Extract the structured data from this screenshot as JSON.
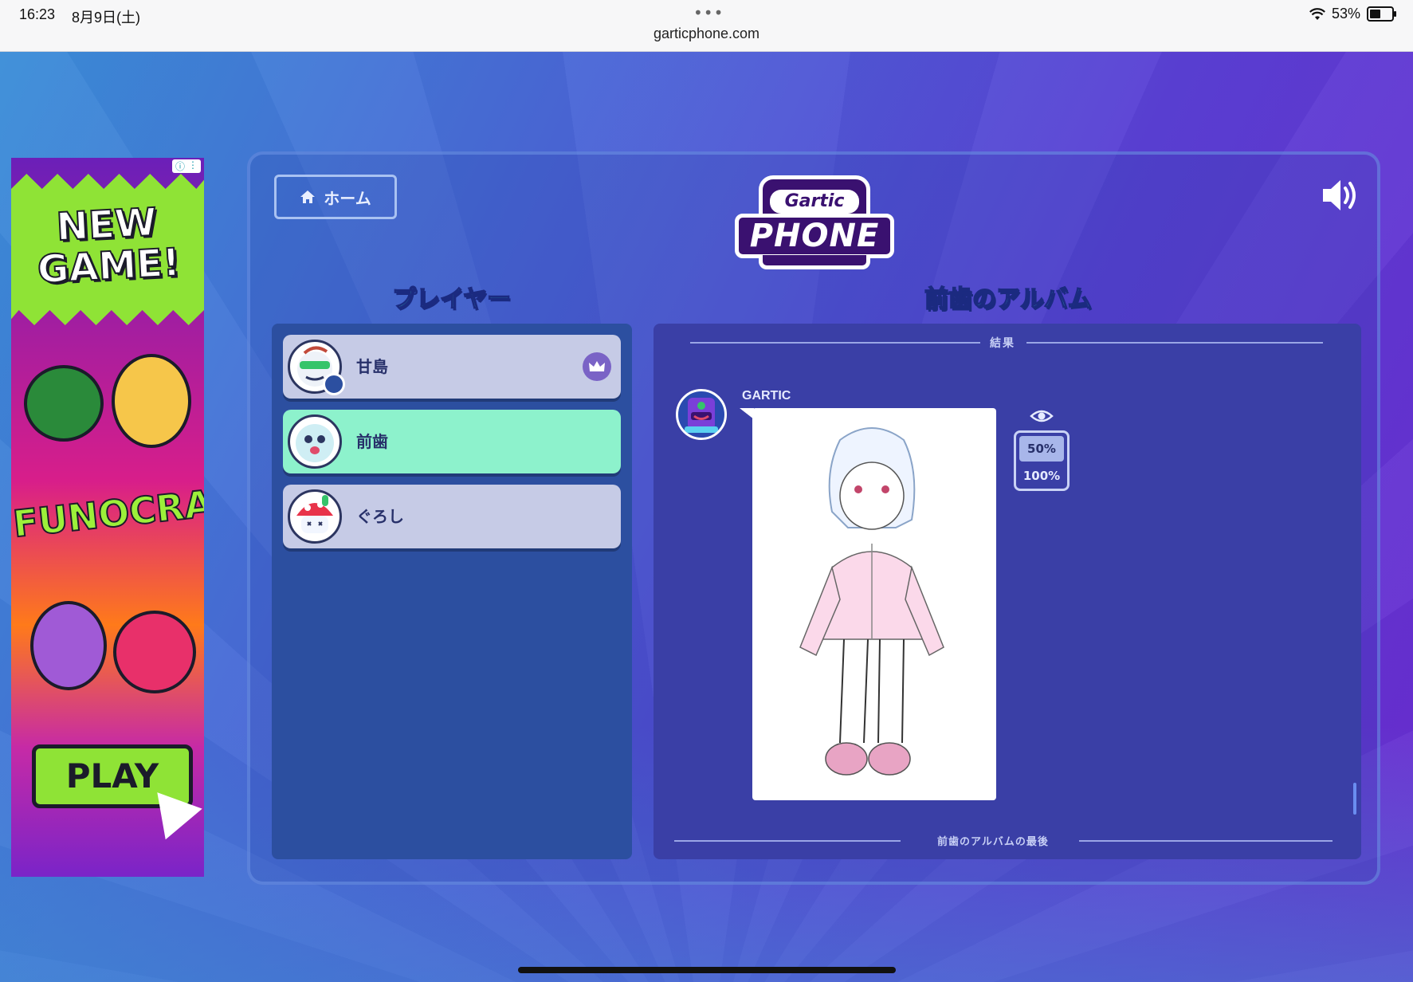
{
  "status_bar": {
    "time": "16:23",
    "date": "8月9日(土)",
    "url": "garticphone.com",
    "battery": "53%",
    "battery_level": 0.53
  },
  "ad": {
    "headline": "NEW GAME!",
    "brand": "FUNOCRACY",
    "cta": "PLAY",
    "info_icon": "info-icon"
  },
  "header": {
    "home_label": "ホーム",
    "logo_top": "Gartic",
    "logo_main": "PHONE"
  },
  "players_section": {
    "title": "プレイヤー",
    "players": [
      {
        "name": "甘島",
        "host": true,
        "active": false
      },
      {
        "name": "前歯",
        "host": false,
        "active": true
      },
      {
        "name": "ぐろし",
        "host": false,
        "active": false
      }
    ]
  },
  "album_section": {
    "title": "前歯のアルバム",
    "result_label": "結果",
    "author": "GARTIC",
    "zoom_options": [
      "50%",
      "100%"
    ],
    "zoom_selected": "50%",
    "end_label": "前歯のアルバムの最後"
  },
  "colors": {
    "accent": "#38e0c8",
    "active_player": "#8df2cc",
    "player_bg": "#c6cbe6"
  }
}
